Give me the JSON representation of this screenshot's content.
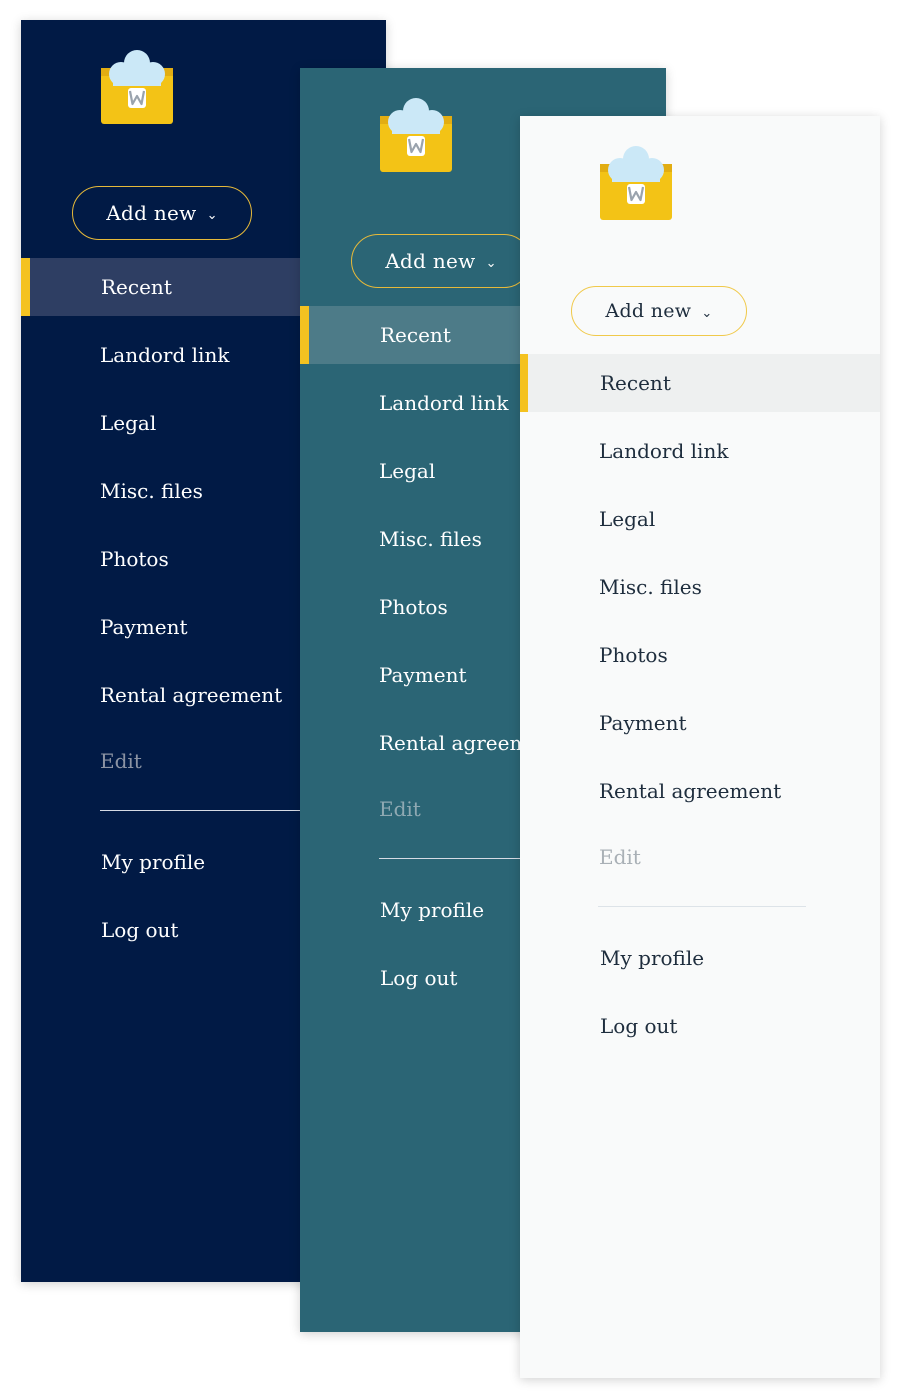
{
  "colors": {
    "navy_bg": "#011a45",
    "teal_bg": "#2b6575",
    "light_bg": "#f9fafa",
    "accent": "#f4c220",
    "button_border": "#e6b93a"
  },
  "logo_icon": "folder-cloud-w-icon",
  "logo_letter": "W",
  "chevron_icon": "chevron-down-icon",
  "panels": [
    {
      "theme": "navy",
      "add_new": "Add new",
      "chevron": "⌄",
      "nav": [
        "Recent",
        "Landord link",
        "Legal",
        "Misc. files",
        "Photos",
        "Payment",
        "Rental agreement"
      ],
      "edit": "Edit",
      "profile": "My profile",
      "logout": "Log out"
    },
    {
      "theme": "teal",
      "add_new": "Add new",
      "chevron": "⌄",
      "nav": [
        "Recent",
        "Landord link",
        "Legal",
        "Misc. files",
        "Photos",
        "Payment",
        "Rental agreement"
      ],
      "edit": "Edit",
      "profile": "My profile",
      "logout": "Log out"
    },
    {
      "theme": "light",
      "add_new": "Add new",
      "chevron": "⌄",
      "nav": [
        "Recent",
        "Landord link",
        "Legal",
        "Misc. files",
        "Photos",
        "Payment",
        "Rental agreement"
      ],
      "edit": "Edit",
      "profile": "My profile",
      "logout": "Log out"
    }
  ]
}
